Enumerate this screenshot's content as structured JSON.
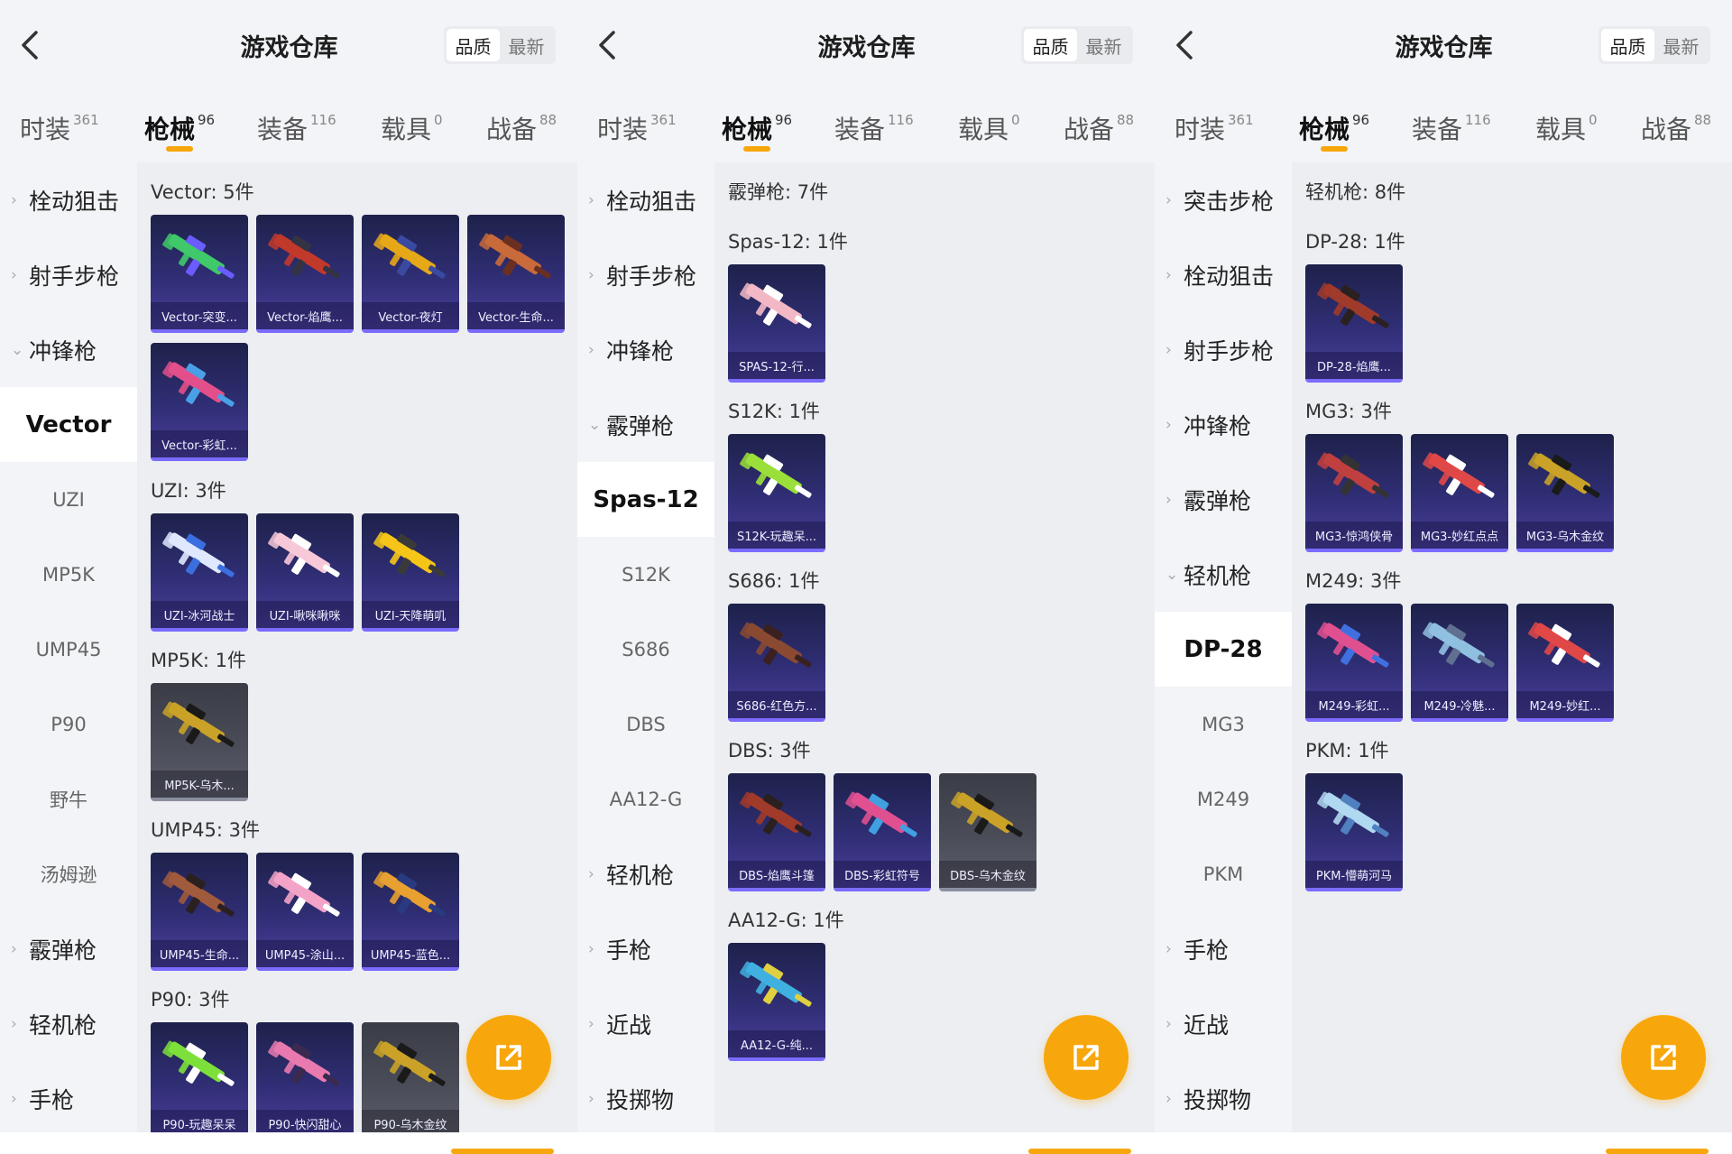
{
  "colors": {
    "accent": "#f7a70b",
    "card_top": "#1e214a",
    "card_bottom": "#4a3f9c",
    "card_edge": "#7b6cff",
    "card_gray": "#4a4c58"
  },
  "panels": [
    {
      "title": "游戏仓库",
      "sort": [
        "品质",
        "最新"
      ],
      "tabs": [
        {
          "label": "时装",
          "count": "361"
        },
        {
          "label": "枪械",
          "count": "96"
        },
        {
          "label": "装备",
          "count": "116"
        },
        {
          "label": "载具",
          "count": "0"
        },
        {
          "label": "战备",
          "count": "88"
        }
      ],
      "sidebar": [
        {
          "label": "栓动狙击",
          "chev": "›"
        },
        {
          "label": "射手步枪",
          "chev": "›"
        },
        {
          "label": "冲锋枪",
          "chev": "⌄"
        },
        {
          "label": "Vector"
        },
        {
          "label": "UZI"
        },
        {
          "label": "MP5K"
        },
        {
          "label": "UMP45"
        },
        {
          "label": "P90"
        },
        {
          "label": "野牛"
        },
        {
          "label": "汤姆逊"
        },
        {
          "label": "霰弹枪",
          "chev": "›"
        },
        {
          "label": "轻机枪",
          "chev": "›"
        },
        {
          "label": "手枪",
          "chev": "›"
        }
      ],
      "sections": [
        "Vector: 5件",
        "UZI: 3件",
        "MP5K: 1件",
        "UMP45: 3件",
        "P90: 3件"
      ],
      "items": [
        {
          "name": "Vector-突变...",
          "icon": "vector-smg-icon",
          "colors": [
            "#3fc96a",
            "#6a5cff"
          ]
        },
        {
          "name": "Vector-焰鹰...",
          "icon": "vector-smg-icon",
          "colors": [
            "#c0392b",
            "#333344"
          ]
        },
        {
          "name": "Vector-夜灯",
          "icon": "vector-smg-icon",
          "colors": [
            "#e6a817",
            "#3a4aa0"
          ]
        },
        {
          "name": "Vector-生命...",
          "icon": "vector-smg-icon",
          "colors": [
            "#c86a3a",
            "#6b2f22"
          ]
        },
        {
          "name": "Vector-彩虹...",
          "icon": "vector-smg-icon",
          "colors": [
            "#e34f8a",
            "#4aa0e6"
          ]
        },
        {
          "name": "UZI-冰河战士",
          "icon": "uzi-icon",
          "colors": [
            "#dfe8ff",
            "#3b6fe0"
          ]
        },
        {
          "name": "UZI-啾咪啾咪",
          "icon": "uzi-icon",
          "colors": [
            "#f7c8d8",
            "#ffffff"
          ]
        },
        {
          "name": "UZI-天降萌叽",
          "icon": "uzi-icon",
          "colors": [
            "#f5c518",
            "#3a3a3a"
          ]
        },
        {
          "name": "MP5K-乌木...",
          "icon": "mp5k-icon",
          "colors": [
            "#c9a227",
            "#1a1a1a"
          ]
        },
        {
          "name": "UMP45-生命...",
          "icon": "ump45-icon",
          "colors": [
            "#a05a3c",
            "#2a2020"
          ]
        },
        {
          "name": "UMP45-涂山...",
          "icon": "ump45-icon",
          "colors": [
            "#f4a3c8",
            "#ffffff"
          ]
        },
        {
          "name": "UMP45-蓝色...",
          "icon": "ump45-icon",
          "colors": [
            "#e8a030",
            "#2a3a80"
          ]
        },
        {
          "name": "P90-玩趣呆呆",
          "icon": "p90-icon",
          "colors": [
            "#7de03a",
            "#ffffff"
          ]
        },
        {
          "name": "P90-快闪甜心",
          "icon": "p90-icon",
          "colors": [
            "#e87ab0",
            "#3a2a50"
          ]
        },
        {
          "name": "P90-乌木金纹",
          "icon": "p90-icon",
          "colors": [
            "#c9a227",
            "#1a1a1a"
          ]
        }
      ],
      "share_icon": "share-export-icon"
    },
    {
      "title": "游戏仓库",
      "sort": [
        "品质",
        "最新"
      ],
      "tabs": [
        {
          "label": "时装",
          "count": "361"
        },
        {
          "label": "枪械",
          "count": "96"
        },
        {
          "label": "装备",
          "count": "116"
        },
        {
          "label": "载具",
          "count": "0"
        },
        {
          "label": "战备",
          "count": "88"
        }
      ],
      "sidebar": [
        {
          "label": "栓动狙击",
          "chev": "›"
        },
        {
          "label": "射手步枪",
          "chev": "›"
        },
        {
          "label": "冲锋枪",
          "chev": "›"
        },
        {
          "label": "霰弹枪",
          "chev": "⌄"
        },
        {
          "label": "Spas-12"
        },
        {
          "label": "S12K"
        },
        {
          "label": "S686"
        },
        {
          "label": "DBS"
        },
        {
          "label": "AA12-G"
        },
        {
          "label": "轻机枪",
          "chev": "›"
        },
        {
          "label": "手枪",
          "chev": "›"
        },
        {
          "label": "近战",
          "chev": "›"
        },
        {
          "label": "投掷物",
          "chev": "›"
        }
      ],
      "sections": [
        "霰弹枪: 7件",
        "Spas-12: 1件",
        "S12K: 1件",
        "S686: 1件",
        "DBS: 3件",
        "AA12-G: 1件"
      ],
      "items": [
        {
          "name": "SPAS-12-行...",
          "icon": "spas12-icon",
          "colors": [
            "#f2b8c6",
            "#ffffff"
          ]
        },
        {
          "name": "S12K-玩趣呆...",
          "icon": "s12k-icon",
          "colors": [
            "#9be03a",
            "#ffffff"
          ]
        },
        {
          "name": "S686-红色方...",
          "icon": "s686-icon",
          "colors": [
            "#8a4a32",
            "#3a2020"
          ]
        },
        {
          "name": "DBS-焰鹰斗篷",
          "icon": "dbs-icon",
          "colors": [
            "#a03a2a",
            "#2a2020"
          ]
        },
        {
          "name": "DBS-彩虹符号",
          "icon": "dbs-icon",
          "colors": [
            "#e05090",
            "#40a0e0"
          ]
        },
        {
          "name": "DBS-乌木金纹",
          "icon": "dbs-icon",
          "colors": [
            "#c9a227",
            "#1a1a1a"
          ]
        },
        {
          "name": "AA12-G-纯...",
          "icon": "aa12g-icon",
          "colors": [
            "#40b0e0",
            "#e0d040"
          ]
        }
      ],
      "share_icon": "share-export-icon"
    },
    {
      "title": "游戏仓库",
      "sort": [
        "品质",
        "最新"
      ],
      "tabs": [
        {
          "label": "时装",
          "count": "361"
        },
        {
          "label": "枪械",
          "count": "96"
        },
        {
          "label": "装备",
          "count": "116"
        },
        {
          "label": "载具",
          "count": "0"
        },
        {
          "label": "战备",
          "count": "88"
        }
      ],
      "sidebar": [
        {
          "label": "突击步枪",
          "chev": "›"
        },
        {
          "label": "栓动狙击",
          "chev": "›"
        },
        {
          "label": "射手步枪",
          "chev": "›"
        },
        {
          "label": "冲锋枪",
          "chev": "›"
        },
        {
          "label": "霰弹枪",
          "chev": "›"
        },
        {
          "label": "轻机枪",
          "chev": "⌄"
        },
        {
          "label": "DP-28"
        },
        {
          "label": "MG3"
        },
        {
          "label": "M249"
        },
        {
          "label": "PKM"
        },
        {
          "label": "手枪",
          "chev": "›"
        },
        {
          "label": "近战",
          "chev": "›"
        },
        {
          "label": "投掷物",
          "chev": "›"
        }
      ],
      "sections": [
        "轻机枪: 8件",
        "DP-28: 1件",
        "MG3: 3件",
        "M249: 3件",
        "PKM: 1件"
      ],
      "items": [
        {
          "name": "DP-28-焰鹰...",
          "icon": "dp28-icon",
          "colors": [
            "#a03a2a",
            "#2a2020"
          ]
        },
        {
          "name": "MG3-惊鸿侠骨",
          "icon": "mg3-icon",
          "colors": [
            "#c04040",
            "#333333"
          ]
        },
        {
          "name": "MG3-妙红点点",
          "icon": "mg3-icon",
          "colors": [
            "#e04848",
            "#ffffff"
          ]
        },
        {
          "name": "MG3-乌木金纹",
          "icon": "mg3-icon",
          "colors": [
            "#c9a227",
            "#1a1a1a"
          ]
        },
        {
          "name": "M249-彩虹...",
          "icon": "m249-icon",
          "colors": [
            "#e05090",
            "#4070e0"
          ]
        },
        {
          "name": "M249-冷魅...",
          "icon": "m249-icon",
          "colors": [
            "#90c0e0",
            "#607090"
          ]
        },
        {
          "name": "M249-妙红...",
          "icon": "m249-icon",
          "colors": [
            "#e04848",
            "#ffffff"
          ]
        },
        {
          "name": "PKM-懵萌河马",
          "icon": "pkm-icon",
          "colors": [
            "#b0d8f0",
            "#5080c0"
          ]
        }
      ],
      "share_icon": "share-export-icon"
    }
  ]
}
